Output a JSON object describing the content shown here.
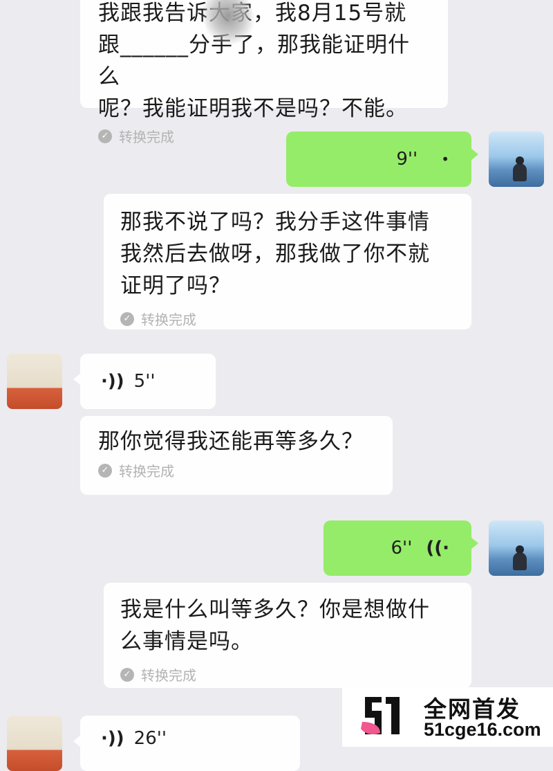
{
  "messages": [
    {
      "id": "m1",
      "side": "left",
      "kind": "transcript",
      "text": "我跟我告诉大家，我8月15号就\n跟______分手了，那我能证明什么\n呢？我能证明我不是吗？不能。",
      "status": "转换完成"
    },
    {
      "id": "m2",
      "side": "right",
      "kind": "voice",
      "duration": "9''",
      "icon": "voice-wave-icon"
    },
    {
      "id": "m3",
      "side": "right",
      "kind": "transcript",
      "text": "那我不说了吗？我分手这件事情\n我然后去做呀，那我做了你不就\n证明了吗？",
      "status": "转换完成"
    },
    {
      "id": "m4",
      "side": "left",
      "kind": "voice",
      "duration": "5''",
      "icon": "voice-wave-icon"
    },
    {
      "id": "m5",
      "side": "left",
      "kind": "transcript",
      "text": "那你觉得我还能再等多久？",
      "status": "转换完成"
    },
    {
      "id": "m6",
      "side": "right",
      "kind": "voice",
      "duration": "6''",
      "icon": "voice-wave-icon"
    },
    {
      "id": "m7",
      "side": "right",
      "kind": "transcript",
      "text": "我是什么叫等多久？你是想做什\n么事情是吗。",
      "status": "转换完成"
    },
    {
      "id": "m8",
      "side": "left",
      "kind": "voice",
      "duration": "26''",
      "icon": "voice-wave-icon"
    }
  ],
  "watermark": {
    "logo": "51",
    "title": "全网首发",
    "site": "51cge16.com"
  },
  "colors": {
    "background": "#ecebf0",
    "bubble_white": "#fefefe",
    "bubble_green": "#95ec69",
    "status_gray": "#b3b3b3",
    "logo_pink": "#f0588f"
  }
}
